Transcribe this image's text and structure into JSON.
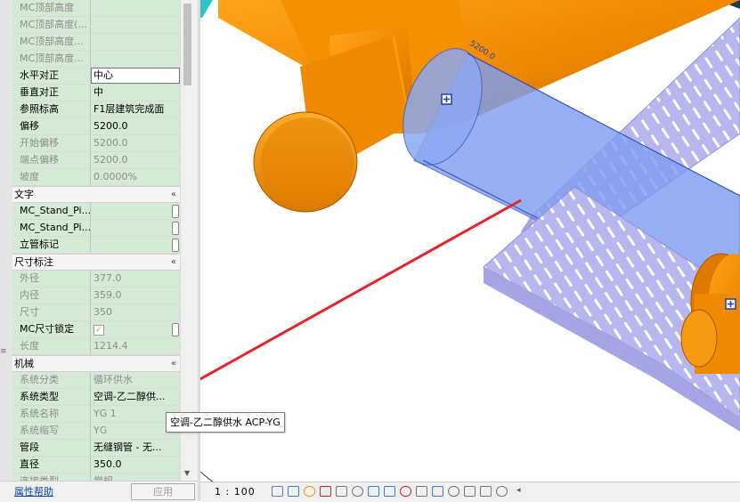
{
  "properties": {
    "rows_top": [
      {
        "name": "MC顶部高度",
        "value": "",
        "dim": true
      },
      {
        "name": "MC顶部高度(...",
        "value": "",
        "dim": true
      },
      {
        "name": "MC顶部高度...",
        "value": "",
        "dim": true
      },
      {
        "name": "MC顶部高度...",
        "value": "",
        "dim": true
      },
      {
        "name": "水平对正",
        "value": "中心",
        "dim": false,
        "edit": true
      },
      {
        "name": "垂直对正",
        "value": "中",
        "dim": false
      },
      {
        "name": "参照标高",
        "value": "F1层建筑完成面",
        "dim": false
      },
      {
        "name": "偏移",
        "value": "5200.0",
        "dim": false
      },
      {
        "name": "开始偏移",
        "value": "5200.0",
        "dim": true
      },
      {
        "name": "端点偏移",
        "value": "5200.0",
        "dim": true
      },
      {
        "name": "坡度",
        "value": "0.0000%",
        "dim": true
      }
    ],
    "group_text": {
      "label": "文字",
      "chevron": "«"
    },
    "rows_text": [
      {
        "name": "MC_Stand_Pi...",
        "value": ""
      },
      {
        "name": "MC_Stand_Pi...",
        "value": ""
      },
      {
        "name": "立管标记",
        "value": ""
      }
    ],
    "group_dims": {
      "label": "尺寸标注",
      "chevron": "«"
    },
    "rows_dims": [
      {
        "name": "外径",
        "value": "377.0",
        "dim": true
      },
      {
        "name": "内径",
        "value": "359.0",
        "dim": true
      },
      {
        "name": "尺寸",
        "value": "350",
        "dim": true
      },
      {
        "name": "MC尺寸锁定",
        "value": "",
        "dim": false,
        "checkbox": "✓"
      },
      {
        "name": "长度",
        "value": "1214.4",
        "dim": true
      }
    ],
    "group_mech": {
      "label": "机械",
      "chevron": "«"
    },
    "rows_mech": [
      {
        "name": "系统分类",
        "value": "循环供水",
        "dim": true
      },
      {
        "name": "系统类型",
        "value": "空调-乙二醇供...",
        "dim": false
      },
      {
        "name": "系统名称",
        "value": "YG 1",
        "dim": true
      },
      {
        "name": "系统缩写",
        "value": "YG",
        "dim": true
      },
      {
        "name": "管段",
        "value": "无缝钢管 - 无...",
        "dim": false
      },
      {
        "name": "直径",
        "value": "350.0",
        "dim": false
      },
      {
        "name": "连接类型",
        "value": "常规",
        "dim": true
      }
    ],
    "help_link": "属性帮助",
    "apply_button": "应用"
  },
  "tooltip": "空调-乙二醇供水 ACP-YG",
  "viewport": {
    "dimension_label": "5200.0",
    "colors": {
      "pipe_orange": "#f08a00",
      "pipe_orange_dark": "#c56a00",
      "selected_pipe": "#7f9ef0",
      "cable_tray": "#b7b7f0",
      "teal": "#2ec4c4",
      "arrow_red": "#e8242a"
    }
  },
  "view_control_bar": {
    "scale": "1 : 100",
    "icons": [
      "detail-level-icon",
      "visual-style-icon",
      "sun-path-icon",
      "shadows-icon",
      "crop-icon",
      "show-crop-icon",
      "unlock-3d-icon",
      "temporary-hide-icon",
      "reveal-hidden-icon",
      "temporary-view-icon",
      "analytical-model-icon",
      "highlight-displacement-icon",
      "worksharing-icon",
      "design-options-icon",
      "constraints-icon"
    ],
    "scroll_chevron": "◂"
  }
}
